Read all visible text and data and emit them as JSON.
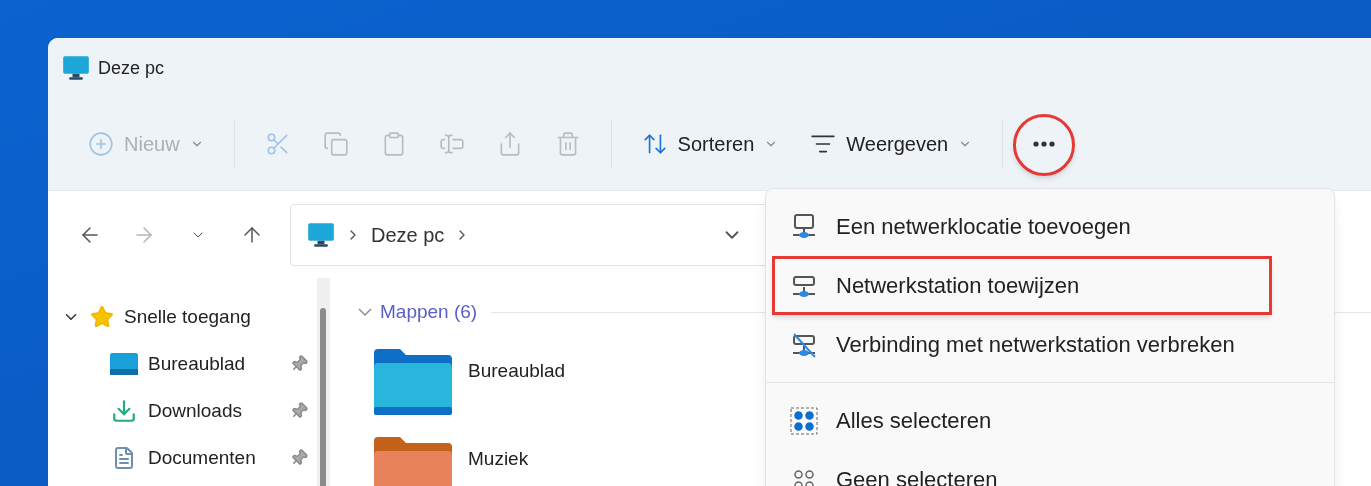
{
  "window": {
    "title": "Deze pc"
  },
  "toolbar": [
    {
      "kind": "new",
      "label": "Nieuw",
      "disabled": true,
      "highlighted": false
    },
    {
      "kind": "separator"
    },
    {
      "kind": "cut",
      "disabled": true,
      "highlighted": false
    },
    {
      "kind": "copy",
      "disabled": true,
      "highlighted": false
    },
    {
      "kind": "paste",
      "disabled": true,
      "highlighted": false
    },
    {
      "kind": "rename",
      "disabled": true,
      "highlighted": false
    },
    {
      "kind": "share",
      "disabled": true,
      "highlighted": false
    },
    {
      "kind": "delete",
      "disabled": true,
      "highlighted": false
    },
    {
      "kind": "separator"
    },
    {
      "kind": "sort",
      "label": "Sorteren",
      "disabled": false,
      "highlighted": false
    },
    {
      "kind": "view",
      "label": "Weergeven",
      "disabled": false,
      "highlighted": false
    },
    {
      "kind": "separator"
    },
    {
      "kind": "more",
      "disabled": false,
      "highlighted": true
    }
  ],
  "navigation": [
    {
      "kind": "back",
      "disabled": false
    },
    {
      "kind": "forward",
      "disabled": true
    },
    {
      "kind": "recent",
      "disabled": false
    },
    {
      "kind": "up",
      "disabled": false
    }
  ],
  "address": {
    "path": [
      "Deze pc"
    ]
  },
  "sidebar": {
    "items": [
      {
        "label": "Snelle toegang",
        "kind": "star",
        "expanded": true,
        "children": [
          {
            "label": "Bureaublad",
            "kind": "desktop",
            "pinned": true
          },
          {
            "label": "Downloads",
            "kind": "downloads",
            "pinned": true
          },
          {
            "label": "Documenten",
            "kind": "documents",
            "pinned": true
          }
        ]
      }
    ]
  },
  "content": {
    "group": {
      "label": "Mappen (6)",
      "expanded": true
    },
    "folders": [
      {
        "label": "Bureaublad",
        "kind": "desktop"
      },
      {
        "label": "Muziek",
        "kind": "music"
      }
    ]
  },
  "menu": [
    {
      "kind": "add-location",
      "label": "Een netwerklocatie toevoegen",
      "highlighted": false
    },
    {
      "kind": "map-drive",
      "label": "Netwerkstation toewijzen",
      "highlighted": true
    },
    {
      "kind": "disconnect",
      "label": "Verbinding met netwerkstation verbreken",
      "highlighted": false
    },
    {
      "kind": "divider"
    },
    {
      "kind": "select-all",
      "label": "Alles selecteren",
      "highlighted": false
    },
    {
      "kind": "select-none",
      "label": "Geen selecteren",
      "highlighted": false
    }
  ]
}
